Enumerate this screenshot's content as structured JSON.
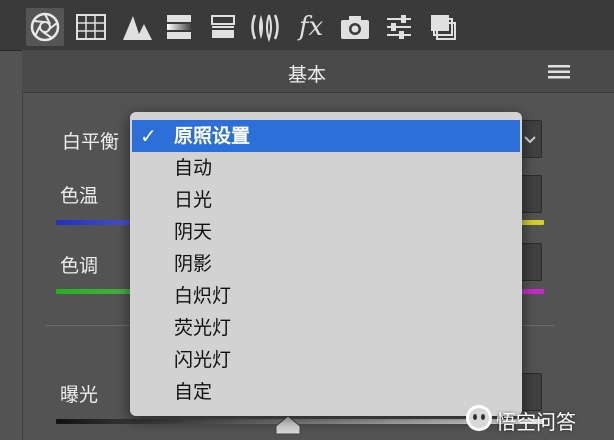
{
  "toolbar": {
    "icons": [
      "aperture-icon",
      "grid-icon",
      "mountains-icon",
      "gradient-icon",
      "split-toning-icon",
      "lens-icon",
      "fx-icon",
      "camera-icon",
      "sliders-icon",
      "presets-icon"
    ],
    "fx_label": "fx"
  },
  "panel": {
    "title": "基本"
  },
  "white_balance": {
    "label": "白平衡",
    "options": [
      "原照设置",
      "自动",
      "日光",
      "阴天",
      "阴影",
      "白炽灯",
      "荧光灯",
      "闪光灯",
      "自定"
    ],
    "selected": "原照设置",
    "check": "✓"
  },
  "sliders": {
    "temp_label": "色温",
    "tint_label": "色调",
    "exposure_label": "曝光"
  },
  "colors": {
    "temp_left": "#1f2fc4",
    "temp_right": "#d8d020",
    "tint_left": "#22b21f",
    "tint_right": "#c726c8",
    "selected_bg": "#2d6fd8"
  },
  "watermark": {
    "text": "悟空问答"
  }
}
